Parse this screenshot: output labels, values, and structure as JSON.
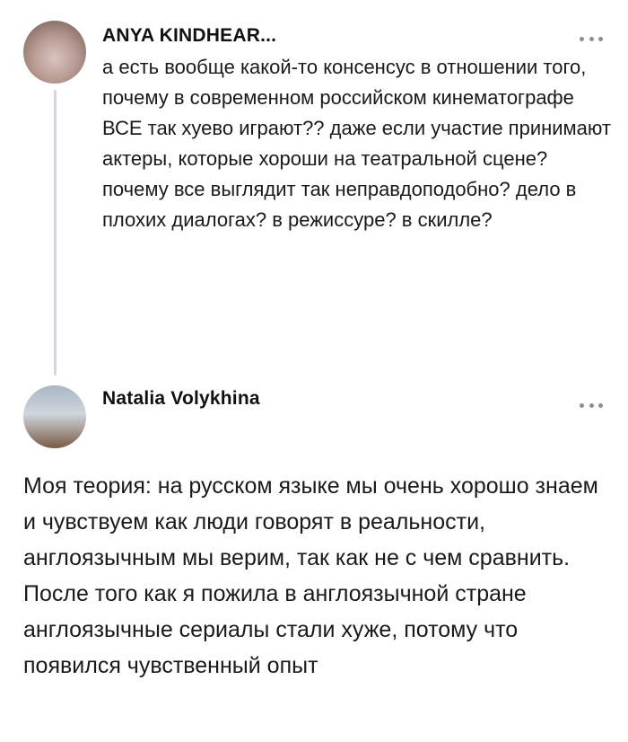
{
  "posts": [
    {
      "author": "ANYA KINDHEAR...",
      "text": "а есть вообще какой-то консенсус в отношении того, почему в современном российском кинематографе ВСЕ так хуево играют?? даже если участие принимают актеры, которые хороши на театральной сцене? почему все выглядит так неправдоподобно? дело в плохих диалогах? в режиссуре? в скилле?",
      "more_icon": "more-horizontal-icon"
    },
    {
      "author": "Natalia Volykhina",
      "text": "Моя теория: на русском языке мы очень хорошо знаем и чувствуем как люди говорят в реальности, англоязычным мы верим, так как не с чем сравнить. После того как я пожила в англоязычной стране англоязычные сериалы стали хуже, потому что появился чувственный опыт",
      "more_icon": "more-horizontal-icon"
    }
  ],
  "colors": {
    "text": "#1a1a1a",
    "muted": "#8a8f96",
    "thread_line": "#d4d7db"
  }
}
